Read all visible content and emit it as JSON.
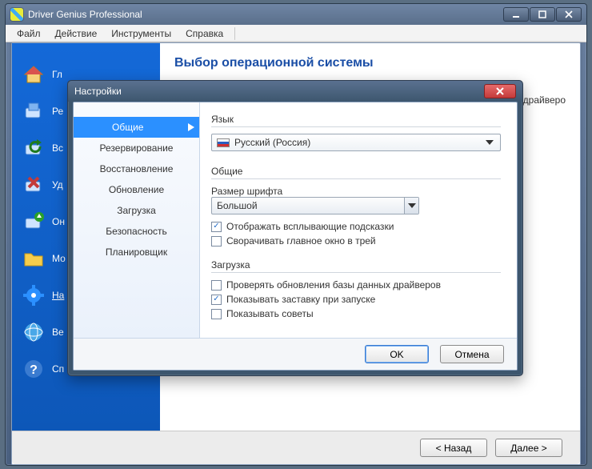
{
  "window": {
    "title": "Driver Genius Professional",
    "menus": {
      "file": "Файл",
      "action": "Действие",
      "tools": "Инструменты",
      "help": "Справка"
    },
    "page_title": "Выбор операционной системы",
    "page_text_fragment": "драйверо",
    "sidebar": {
      "items": [
        {
          "label": "Гл"
        },
        {
          "label": "Ре"
        },
        {
          "label": "Вс"
        },
        {
          "label": "Уд"
        },
        {
          "label": "Он"
        },
        {
          "label": "Мо"
        },
        {
          "label": "На"
        },
        {
          "label": "Ве"
        },
        {
          "label": "Сп"
        }
      ]
    },
    "footer": {
      "back": "< Назад",
      "next": "Далее >"
    }
  },
  "dialog": {
    "title": "Настройки",
    "categories": [
      "Общие",
      "Резервирование",
      "Восстановление",
      "Обновление",
      "Загрузка",
      "Безопасность",
      "Планировщик"
    ],
    "section_language": {
      "label": "Язык",
      "selected": "Русский (Россия)"
    },
    "section_general": {
      "label": "Общие",
      "font_size_label": "Размер шрифта",
      "font_size_value": "Большой",
      "cb_tooltips": {
        "checked": true,
        "label": "Отображать всплывающие подсказки"
      },
      "cb_tray": {
        "checked": false,
        "label": "Сворачивать главное окно в трей"
      }
    },
    "section_download": {
      "label": "Загрузка",
      "cb_check_updates": {
        "checked": false,
        "label": "Проверять обновления базы данных драйверов"
      },
      "cb_splash": {
        "checked": true,
        "label": "Показывать заставку при запуске"
      },
      "cb_tips": {
        "checked": false,
        "label": "Показывать советы"
      }
    },
    "buttons": {
      "ok": "OK",
      "cancel": "Отмена"
    }
  }
}
